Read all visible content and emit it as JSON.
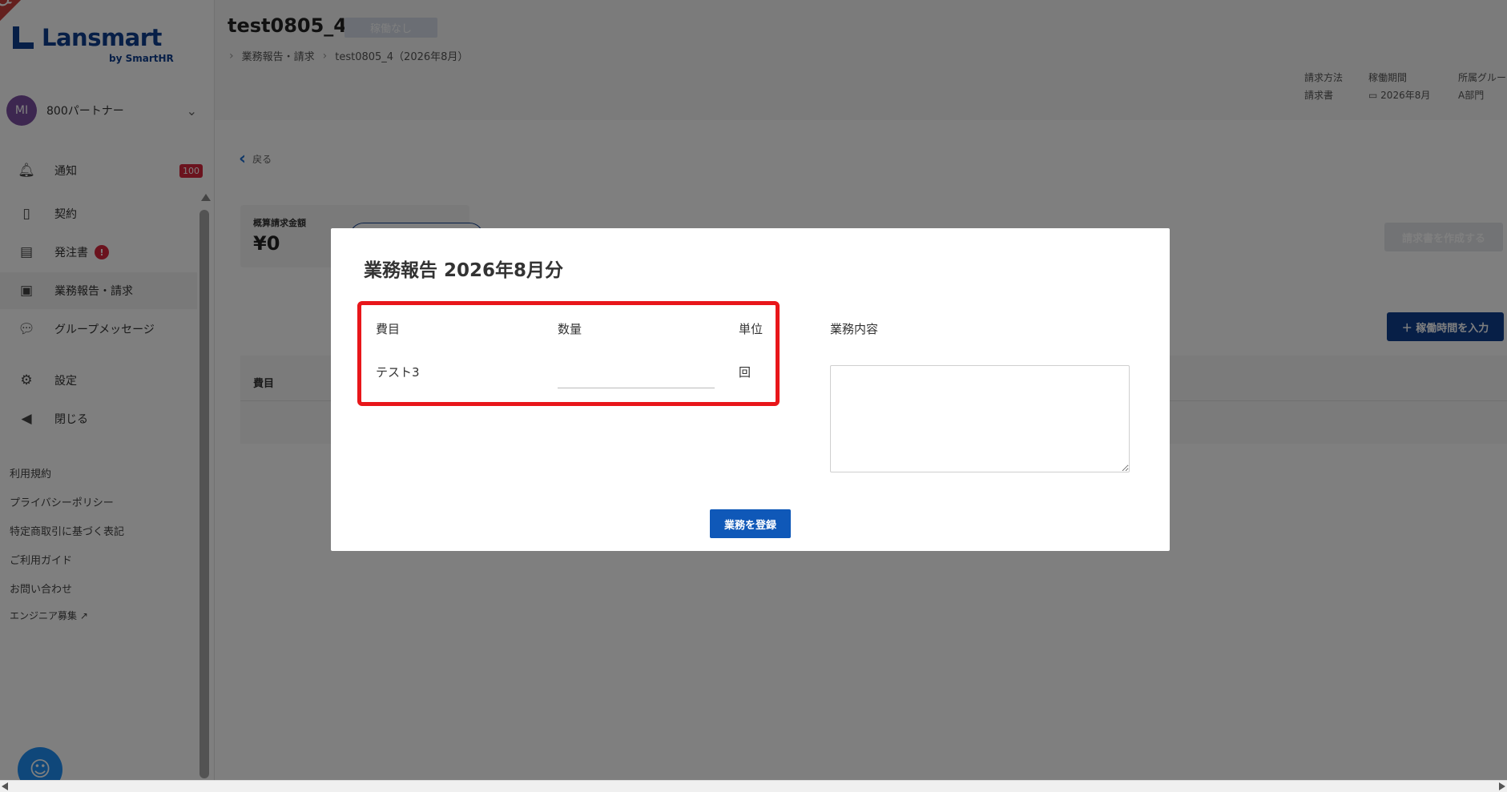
{
  "sidebar": {
    "brand": "Lansmart",
    "brand_sub": "by SmartHR",
    "ribbon": "QA",
    "account": {
      "initials": "MI",
      "name": "800パートナー"
    },
    "nav": [
      {
        "label": "通知",
        "badge": "100"
      },
      {
        "label": "契約"
      },
      {
        "label": "発注書",
        "badge": "!"
      },
      {
        "label": "業務報告・請求"
      },
      {
        "label": "グループメッセージ"
      },
      {
        "label": "設定"
      },
      {
        "label": "閉じる"
      }
    ],
    "footer_links": [
      "利用規約",
      "プライバシーポリシー",
      "特定商取引に基づく表記",
      "ご利用ガイド",
      "お問い合わせ",
      "エンジニア募集"
    ]
  },
  "header": {
    "title": "test0805_4",
    "status": "稼働なし",
    "breadcrumb": [
      "業務報告・請求",
      "test0805_4（2026年8月）"
    ],
    "meta": [
      {
        "label": "請求方法",
        "value": "請求書"
      },
      {
        "label": "稼働期間",
        "value": "2026年8月"
      },
      {
        "label": "所属グルー",
        "value": "A部門"
      }
    ]
  },
  "page": {
    "back": "戻る",
    "summary_label": "概算請求金額",
    "summary_value": "¥0",
    "invoice_button": "請求書を作成する",
    "hours_button": "＋ 稼働時間を入力",
    "table_head": "費目"
  },
  "modal": {
    "title": "業務報告 2026年8月分",
    "columns": {
      "item": "費目",
      "quantity": "数量",
      "unit": "単位",
      "content": "業務内容"
    },
    "row": {
      "item": "テスト3",
      "quantity": "",
      "unit": "回"
    },
    "content_value": "",
    "submit": "業務を登録"
  }
}
